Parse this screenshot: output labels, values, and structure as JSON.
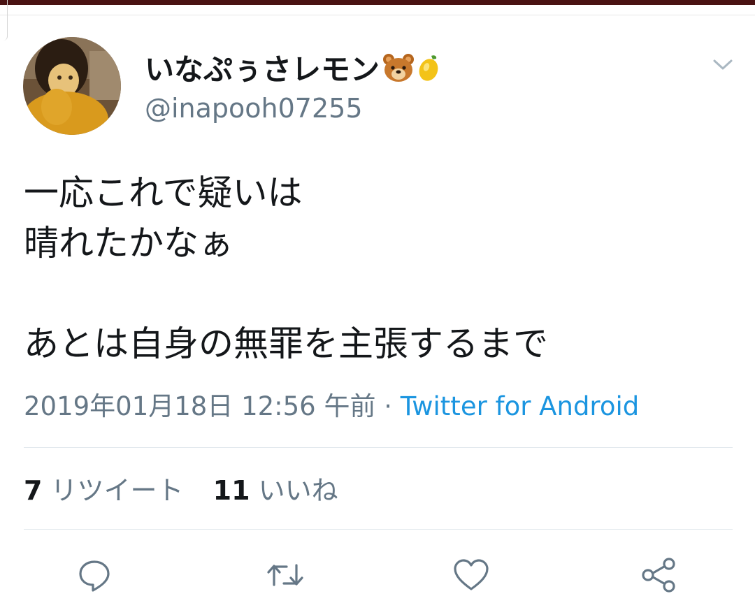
{
  "author": {
    "display_name": "いなぷぅさレモン",
    "emoji": [
      "bear-face-icon",
      "lemon-icon"
    ],
    "handle": "@inapooh07255"
  },
  "tweet": {
    "lines": [
      "一応これで疑いは",
      "晴れたかなぁ",
      "",
      "あとは自身の無罪を主張するまで"
    ],
    "timestamp": "2019年01月18日 12:56 午前",
    "separator": " · ",
    "source": "Twitter for Android"
  },
  "stats": {
    "retweets_count": "7",
    "retweets_label": "リツイート",
    "likes_count": "11",
    "likes_label": "いいね"
  },
  "actions": [
    "reply-icon",
    "retweet-icon",
    "like-icon",
    "share-icon"
  ],
  "colors": {
    "accent": "#1b95e0",
    "secondary_text": "#657786",
    "top_bar": "#4a1313"
  }
}
